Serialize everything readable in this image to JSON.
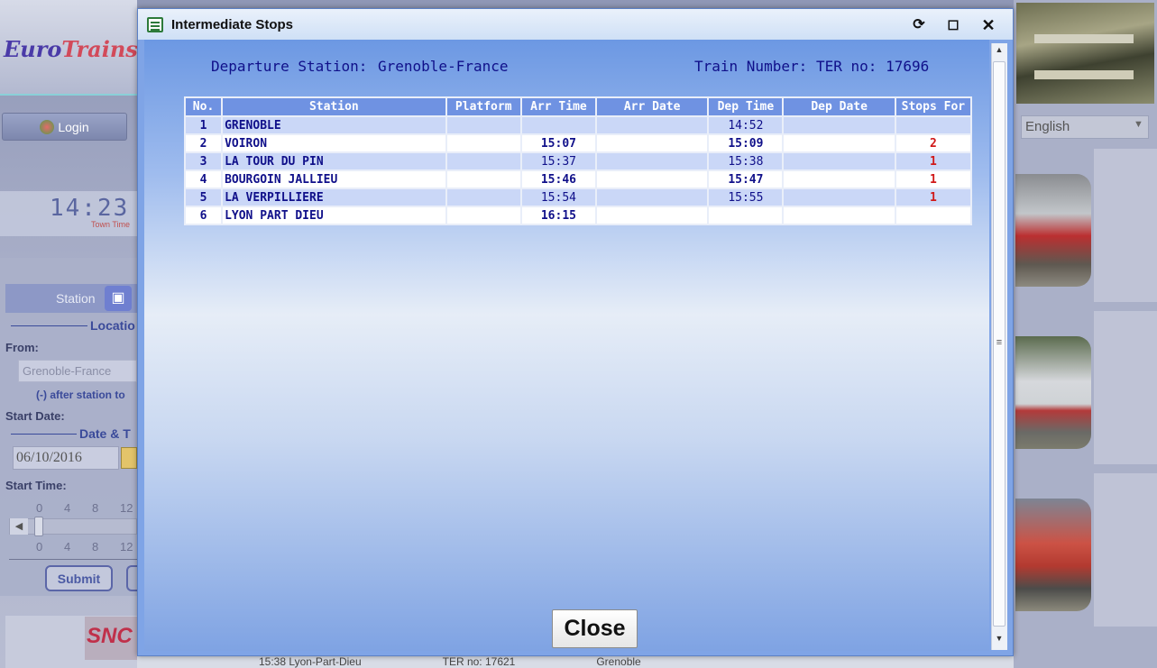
{
  "background": {
    "logo": {
      "part1": "Euro",
      "part2": "Trains"
    },
    "login_label": "Login",
    "clock": {
      "time": "14:23",
      "sub": "Town Time"
    },
    "station_tab": "Station",
    "location_label": "Locatio",
    "from_label": "From:",
    "from_value": "Grenoble-France",
    "after_note": "(-) after station to",
    "start_date_label": "Start Date:",
    "date_time_label": "Date & T",
    "date_value": "06/10/2016",
    "start_time_label": "Start Time:",
    "ticks": [
      "0",
      "4",
      "8",
      "12"
    ],
    "submit_label": "Submit",
    "sncf_label": "SNC",
    "language": "English",
    "bottom_row": {
      "time_text": "15:38  Lyon-Part-Dieu",
      "train_text": "TER no: 17621",
      "station_text": "Grenoble"
    }
  },
  "dialog": {
    "title": "Intermediate Stops",
    "departure_label": "Departure Station:",
    "departure_value": "Grenoble-France",
    "train_label": "Train Number:",
    "train_value": "TER no: 17696",
    "columns": [
      "No.",
      "Station",
      "Platform",
      "Arr Time",
      "Arr Date",
      "Dep Time",
      "Dep Date",
      "Stops For"
    ],
    "rows": [
      {
        "no": "1",
        "station": "GRENOBLE",
        "platform": "",
        "arr_time": "",
        "arr_date": "",
        "dep_time": "14:52",
        "dep_date": "",
        "stops_for": ""
      },
      {
        "no": "2",
        "station": "VOIRON",
        "platform": "",
        "arr_time": "15:07",
        "arr_date": "",
        "dep_time": "15:09",
        "dep_date": "",
        "stops_for": "2"
      },
      {
        "no": "3",
        "station": "LA TOUR DU PIN",
        "platform": "",
        "arr_time": "15:37",
        "arr_date": "",
        "dep_time": "15:38",
        "dep_date": "",
        "stops_for": "1"
      },
      {
        "no": "4",
        "station": "BOURGOIN JALLIEU",
        "platform": "",
        "arr_time": "15:46",
        "arr_date": "",
        "dep_time": "15:47",
        "dep_date": "",
        "stops_for": "1"
      },
      {
        "no": "5",
        "station": "LA VERPILLIERE",
        "platform": "",
        "arr_time": "15:54",
        "arr_date": "",
        "dep_time": "15:55",
        "dep_date": "",
        "stops_for": "1"
      },
      {
        "no": "6",
        "station": "LYON PART DIEU",
        "platform": "",
        "arr_time": "16:15",
        "arr_date": "",
        "dep_time": "",
        "dep_date": "",
        "stops_for": ""
      }
    ],
    "close_label": "Close",
    "icons": {
      "window": "list-window-icon",
      "restore": "restore-icon",
      "maximize": "maximize-icon",
      "close": "close-icon"
    }
  },
  "colors": {
    "header_blue": "#6f92e2",
    "text_navy": "#10108a",
    "stop_red": "#d01818"
  }
}
